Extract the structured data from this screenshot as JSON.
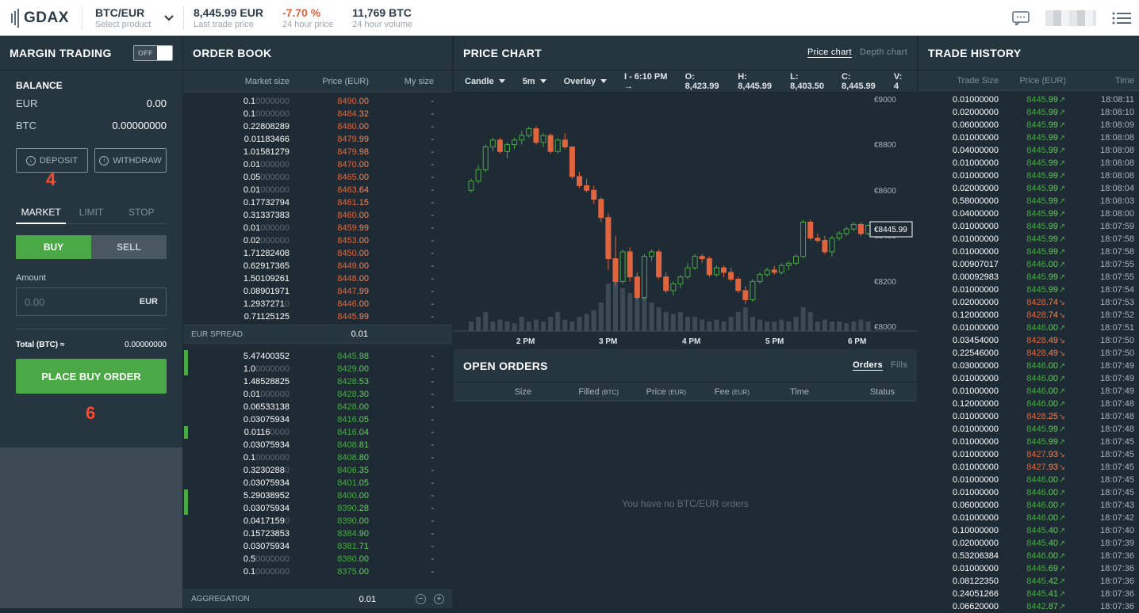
{
  "header": {
    "logo": "GDAX",
    "product": "BTC/EUR",
    "product_sub": "Select product",
    "last_price": "8,445.99 EUR",
    "last_price_label": "Last trade price",
    "change": "-7.70 %",
    "change_label": "24 hour price",
    "volume": "11,769 BTC",
    "volume_label": "24 hour volume"
  },
  "margin": {
    "title": "MARGIN TRADING",
    "toggle": "OFF"
  },
  "balance": {
    "title": "BALANCE",
    "rows": [
      {
        "k": "EUR",
        "v": "0.00"
      },
      {
        "k": "BTC",
        "v": "0.00000000"
      }
    ],
    "deposit": "DEPOSIT",
    "withdraw": "WITHDRAW"
  },
  "annotations": {
    "a4": "4",
    "a6": "6"
  },
  "order_form": {
    "tabs": [
      "MARKET",
      "LIMIT",
      "STOP"
    ],
    "buy": "BUY",
    "sell": "SELL",
    "amount_label": "Amount",
    "amount_placeholder": "0.00",
    "amount_unit": "EUR",
    "total_label": "Total (BTC) ≈",
    "total_value": "0.00000000",
    "place": "PLACE BUY ORDER"
  },
  "orderbook": {
    "title": "ORDER BOOK",
    "cols": [
      "Market size",
      "Price (EUR)",
      "My size"
    ],
    "asks": [
      [
        "0.1",
        "0000000",
        "8490",
        ".00"
      ],
      [
        "0.1",
        "0000000",
        "8484",
        ".32"
      ],
      [
        "0.22808289",
        "",
        "8480",
        ".00"
      ],
      [
        "0.01183466",
        "",
        "8479",
        ".99"
      ],
      [
        "1.01581279",
        "",
        "8479",
        ".98"
      ],
      [
        "0.01",
        "000000",
        "8470",
        ".00"
      ],
      [
        "0.05",
        "000000",
        "8465",
        ".00"
      ],
      [
        "0.01",
        "000000",
        "8463",
        ".64"
      ],
      [
        "0.17732794",
        "",
        "8461",
        ".15"
      ],
      [
        "0.31337383",
        "",
        "8460",
        ".00"
      ],
      [
        "0.01",
        "000000",
        "8459",
        ".99"
      ],
      [
        "0.02",
        "000000",
        "8453",
        ".00"
      ],
      [
        "1.71282408",
        "",
        "8450",
        ".00"
      ],
      [
        "0.62917365",
        "",
        "8449",
        ".00"
      ],
      [
        "1.50109261",
        "",
        "8448",
        ".00"
      ],
      [
        "0.08901971",
        "",
        "8447",
        ".99"
      ],
      [
        "1.2937271",
        "0",
        "8446",
        ".00"
      ],
      [
        "0.71125125",
        "",
        "8445",
        ".99"
      ]
    ],
    "spread_label": "EUR SPREAD",
    "spread": "0.01",
    "bids": [
      [
        "5.47400352",
        "",
        "8445",
        ".98"
      ],
      [
        "1.0",
        "0000000",
        "8429",
        ".00"
      ],
      [
        "1.48528825",
        "",
        "8428",
        ".53"
      ],
      [
        "0.01",
        "000000",
        "8428",
        ".30"
      ],
      [
        "0.06533138",
        "",
        "8428",
        ".00"
      ],
      [
        "0.03075934",
        "",
        "8416",
        ".05"
      ],
      [
        "0.0116",
        "0000",
        "8416",
        ".04"
      ],
      [
        "0.03075934",
        "",
        "8408",
        ".81"
      ],
      [
        "0.1",
        "0000000",
        "8408",
        ".80"
      ],
      [
        "0.3230288",
        "0",
        "8406",
        ".35"
      ],
      [
        "0.03075934",
        "",
        "8401",
        ".05"
      ],
      [
        "5.29038952",
        "",
        "8400",
        ".00"
      ],
      [
        "0.03075934",
        "",
        "8390",
        ".28"
      ],
      [
        "0.0417159",
        "0",
        "8390",
        ".00"
      ],
      [
        "0.15723853",
        "",
        "8384",
        ".90"
      ],
      [
        "0.03075934",
        "",
        "8381",
        ".71"
      ],
      [
        "0.5",
        "0000000",
        "8380",
        ".00"
      ],
      [
        "0.1",
        "0000000",
        "8375",
        ".00"
      ]
    ],
    "my_size": "-",
    "agg_label": "AGGREGATION",
    "agg": "0.01"
  },
  "price_chart": {
    "title": "PRICE CHART",
    "tab_price": "Price chart",
    "tab_depth": "Depth chart",
    "candle": "Candle",
    "interval": "5m",
    "overlay": "Overlay",
    "time": "I - 6:10 PM →",
    "ohlc": [
      "O: 8,423.99",
      "H: 8,445.99",
      "L: 8,403.50",
      "C: 8,445.99",
      "V: 4"
    ],
    "y_ticks": [
      "€9000",
      "€8800",
      "€8600",
      "€8400",
      "€8200",
      "€8000"
    ],
    "x_ticks": [
      "2 PM",
      "3 PM",
      "4 PM",
      "5 PM",
      "6 PM"
    ],
    "last": "€8445.99",
    "colors": {
      "up": "#4aa846",
      "down": "#e0653e"
    }
  },
  "chart_data": {
    "type": "candlestick",
    "ylim": [
      8000,
      9000
    ],
    "candles": [
      [
        8600,
        8650,
        8590,
        8640
      ],
      [
        8640,
        8710,
        8630,
        8690
      ],
      [
        8690,
        8800,
        8680,
        8790
      ],
      [
        8790,
        8830,
        8770,
        8820
      ],
      [
        8820,
        8830,
        8760,
        8770
      ],
      [
        8770,
        8810,
        8740,
        8800
      ],
      [
        8800,
        8830,
        8780,
        8820
      ],
      [
        8820,
        8860,
        8800,
        8840
      ],
      [
        8840,
        8880,
        8830,
        8870
      ],
      [
        8870,
        8880,
        8800,
        8810
      ],
      [
        8810,
        8850,
        8790,
        8840
      ],
      [
        8840,
        8850,
        8760,
        8770
      ],
      [
        8770,
        8830,
        8760,
        8820
      ],
      [
        8820,
        8850,
        8780,
        8790
      ],
      [
        8790,
        8790,
        8650,
        8660
      ],
      [
        8660,
        8680,
        8610,
        8620
      ],
      [
        8620,
        8650,
        8590,
        8600
      ],
      [
        8600,
        8620,
        8540,
        8560
      ],
      [
        8560,
        8570,
        8460,
        8480
      ],
      [
        8480,
        8500,
        8250,
        8300
      ],
      [
        8300,
        8400,
        8180,
        8200
      ],
      [
        8200,
        8340,
        8190,
        8330
      ],
      [
        8330,
        8350,
        8200,
        8220
      ],
      [
        8220,
        8240,
        8120,
        8130
      ],
      [
        8130,
        8320,
        8120,
        8310
      ],
      [
        8310,
        8340,
        8290,
        8330
      ],
      [
        8330,
        8340,
        8210,
        8220
      ],
      [
        8220,
        8240,
        8150,
        8160
      ],
      [
        8160,
        8200,
        8140,
        8190
      ],
      [
        8190,
        8230,
        8170,
        8220
      ],
      [
        8220,
        8280,
        8210,
        8260
      ],
      [
        8260,
        8320,
        8250,
        8310
      ],
      [
        8310,
        8320,
        8280,
        8300
      ],
      [
        8300,
        8310,
        8220,
        8230
      ],
      [
        8230,
        8270,
        8220,
        8260
      ],
      [
        8260,
        8270,
        8220,
        8240
      ],
      [
        8240,
        8260,
        8200,
        8210
      ],
      [
        8210,
        8220,
        8150,
        8160
      ],
      [
        8160,
        8180,
        8100,
        8120
      ],
      [
        8120,
        8210,
        8110,
        8200
      ],
      [
        8200,
        8240,
        8190,
        8230
      ],
      [
        8230,
        8260,
        8220,
        8250
      ],
      [
        8250,
        8270,
        8230,
        8240
      ],
      [
        8240,
        8280,
        8230,
        8270
      ],
      [
        8270,
        8290,
        8250,
        8280
      ],
      [
        8280,
        8320,
        8270,
        8310
      ],
      [
        8310,
        8470,
        8300,
        8460
      ],
      [
        8460,
        8470,
        8380,
        8390
      ],
      [
        8390,
        8410,
        8370,
        8380
      ],
      [
        8380,
        8400,
        8320,
        8330
      ],
      [
        8330,
        8400,
        8310,
        8390
      ],
      [
        8390,
        8420,
        8380,
        8410
      ],
      [
        8410,
        8440,
        8400,
        8430
      ],
      [
        8430,
        8460,
        8420,
        8450
      ],
      [
        8450,
        8460,
        8400,
        8410
      ],
      [
        8410,
        8450,
        8400,
        8446
      ]
    ],
    "volumes": [
      0.1,
      0.15,
      0.2,
      0.1,
      0.12,
      0.1,
      0.08,
      0.15,
      0.1,
      0.12,
      0.1,
      0.15,
      0.2,
      0.12,
      0.1,
      0.15,
      0.18,
      0.22,
      0.3,
      0.5,
      0.6,
      0.45,
      0.4,
      0.5,
      0.35,
      0.3,
      0.25,
      0.2,
      0.18,
      0.2,
      0.15,
      0.15,
      0.12,
      0.1,
      0.12,
      0.1,
      0.15,
      0.2,
      0.25,
      0.15,
      0.12,
      0.1,
      0.1,
      0.12,
      0.1,
      0.15,
      0.25,
      0.2,
      0.1,
      0.12,
      0.1,
      0.1,
      0.08,
      0.1,
      0.12,
      0.1
    ]
  },
  "open_orders": {
    "title": "OPEN ORDERS",
    "tab_orders": "Orders",
    "tab_fills": "Fills",
    "cols": [
      "Size",
      "Filled",
      "(BTC)",
      "Price",
      "(EUR)",
      "Fee",
      "(EUR)",
      "Time",
      "Status"
    ],
    "empty": "You have no BTC/EUR orders"
  },
  "trade_history": {
    "title": "TRADE HISTORY",
    "cols": [
      "Trade Size",
      "Price (EUR)",
      "Time"
    ],
    "rows": [
      [
        "0.01000000",
        "8445",
        ".99",
        "up",
        "18:08:11"
      ],
      [
        "0.02000000",
        "8445",
        ".99",
        "up",
        "18:08:10"
      ],
      [
        "0.06000000",
        "8445",
        ".99",
        "up",
        "18:08:09"
      ],
      [
        "0.01000000",
        "8445",
        ".99",
        "up",
        "18:08:08"
      ],
      [
        "0.04000000",
        "8445",
        ".99",
        "up",
        "18:08:08"
      ],
      [
        "0.01000000",
        "8445",
        ".99",
        "up",
        "18:08:08"
      ],
      [
        "0.01000000",
        "8445",
        ".99",
        "up",
        "18:08:08"
      ],
      [
        "0.02000000",
        "8445",
        ".99",
        "up",
        "18:08:04"
      ],
      [
        "0.58000000",
        "8445",
        ".99",
        "up",
        "18:08:03"
      ],
      [
        "0.04000000",
        "8445",
        ".99",
        "up",
        "18:08:00"
      ],
      [
        "0.01000000",
        "8445",
        ".99",
        "up",
        "18:07:59"
      ],
      [
        "0.01000000",
        "8445",
        ".99",
        "up",
        "18:07:58"
      ],
      [
        "0.01000000",
        "8445",
        ".99",
        "up",
        "18:07:58"
      ],
      [
        "0.00907017",
        "8446",
        ".00",
        "up",
        "18:07:55"
      ],
      [
        "0.00092983",
        "8445",
        ".99",
        "up",
        "18:07:55"
      ],
      [
        "0.01000000",
        "8445",
        ".99",
        "up",
        "18:07:54"
      ],
      [
        "0.02000000",
        "8428",
        ".74",
        "down",
        "18:07:53"
      ],
      [
        "0.12000000",
        "8428",
        ".74",
        "down",
        "18:07:52"
      ],
      [
        "0.01000000",
        "8446",
        ".00",
        "up",
        "18:07:51"
      ],
      [
        "0.03454000",
        "8428",
        ".49",
        "down",
        "18:07:50"
      ],
      [
        "0.22546000",
        "8428",
        ".49",
        "down",
        "18:07:50"
      ],
      [
        "0.03000000",
        "8446",
        ".00",
        "up",
        "18:07:49"
      ],
      [
        "0.01000000",
        "8446",
        ".00",
        "up",
        "18:07:49"
      ],
      [
        "0.01000000",
        "8446",
        ".00",
        "up",
        "18:07:49"
      ],
      [
        "0.12000000",
        "8446",
        ".00",
        "up",
        "18:07:48"
      ],
      [
        "0.01000000",
        "8428",
        ".25",
        "down",
        "18:07:48"
      ],
      [
        "0.01000000",
        "8445",
        ".99",
        "up",
        "18:07:48"
      ],
      [
        "0.01000000",
        "8445",
        ".99",
        "up",
        "18:07:45"
      ],
      [
        "0.01000000",
        "8427",
        ".93",
        "down",
        "18:07:45"
      ],
      [
        "0.01000000",
        "8427",
        ".93",
        "down",
        "18:07:45"
      ],
      [
        "0.01000000",
        "8446",
        ".00",
        "up",
        "18:07:45"
      ],
      [
        "0.01000000",
        "8446",
        ".00",
        "up",
        "18:07:45"
      ],
      [
        "0.06000000",
        "8446",
        ".00",
        "up",
        "18:07:43"
      ],
      [
        "0.01000000",
        "8446",
        ".00",
        "up",
        "18:07:42"
      ],
      [
        "0.10000000",
        "8445",
        ".40",
        "up",
        "18:07:40"
      ],
      [
        "0.02000000",
        "8445",
        ".40",
        "up",
        "18:07:39"
      ],
      [
        "0.53206384",
        "8446",
        ".00",
        "up",
        "18:07:36"
      ],
      [
        "0.01000000",
        "8445",
        ".69",
        "up",
        "18:07:36"
      ],
      [
        "0.08122350",
        "8445",
        ".42",
        "up",
        "18:07:36"
      ],
      [
        "0.24051266",
        "8445",
        ".41",
        "up",
        "18:07:36"
      ],
      [
        "0.06620000",
        "8442",
        ".87",
        "up",
        "18:07:36"
      ]
    ]
  }
}
